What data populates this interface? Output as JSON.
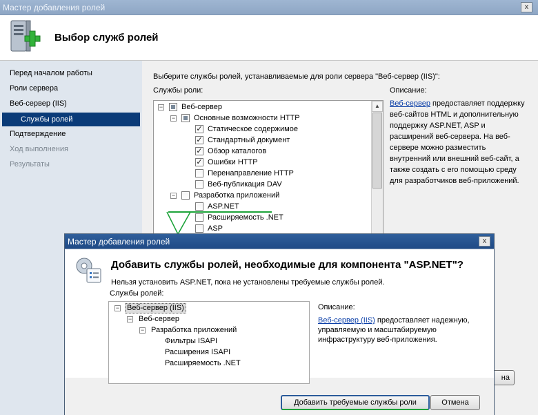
{
  "main_window": {
    "title": "Мастер добавления ролей",
    "close_glyph": "x",
    "header_title": "Выбор служб ролей",
    "nav": [
      {
        "label": "Перед началом работы",
        "state": "normal"
      },
      {
        "label": "Роли сервера",
        "state": "normal"
      },
      {
        "label": "Веб-сервер (IIS)",
        "state": "normal"
      },
      {
        "label": "Службы ролей",
        "state": "active"
      },
      {
        "label": "Подтверждение",
        "state": "normal"
      },
      {
        "label": "Ход выполнения",
        "state": "disabled"
      },
      {
        "label": "Результаты",
        "state": "disabled"
      }
    ],
    "instruction": "Выберите службы ролей, устанавливаемые для роли сервера \"Веб-сервер (IIS)\":",
    "services_label": "Службы роли:",
    "description_label": "Описание:",
    "tree": [
      {
        "label": "Веб-сервер",
        "level": 0,
        "checkbox": "partial",
        "expander": "−"
      },
      {
        "label": "Основные возможности HTTP",
        "level": 1,
        "checkbox": "partial",
        "expander": "−"
      },
      {
        "label": "Статическое содержимое",
        "level": 2,
        "checkbox": "checked"
      },
      {
        "label": "Стандартный документ",
        "level": 2,
        "checkbox": "checked"
      },
      {
        "label": "Обзор каталогов",
        "level": 2,
        "checkbox": "checked"
      },
      {
        "label": "Ошибки HTTP",
        "level": 2,
        "checkbox": "checked"
      },
      {
        "label": "Перенаправление HTTP",
        "level": 2,
        "checkbox": "unchecked"
      },
      {
        "label": "Веб-публикация DAV",
        "level": 2,
        "checkbox": "unchecked"
      },
      {
        "label": "Разработка приложений",
        "level": 1,
        "checkbox": "unchecked",
        "expander": "−"
      },
      {
        "label": "ASP.NET",
        "level": 2,
        "checkbox": "unchecked"
      },
      {
        "label": "Расширяемость .NET",
        "level": 2,
        "checkbox": "unchecked"
      },
      {
        "label": "ASP",
        "level": 2,
        "checkbox": "unchecked"
      }
    ],
    "description": {
      "link": "Веб-сервер",
      "text": " предоставляет поддержку веб-сайтов HTML и дополнительную поддержку ASP.NET, ASP и расширений веб-сервера. На веб-сервере можно разместить внутренний или внешний веб-сайт, а также создать с его помощью среду для разработчиков веб-приложений."
    },
    "partial_button_text": "на"
  },
  "dialog": {
    "title": "Мастер добавления ролей",
    "close_glyph": "x",
    "heading": "Добавить службы ролей, необходимые для компонента \"ASP.NET\"?",
    "subtitle": "Нельзя установить ASP.NET, пока не установлены требуемые службы ролей.",
    "services_label": "Службы ролей:",
    "description_label": "Описание:",
    "tree": [
      {
        "label": "Веб-сервер (IIS)",
        "level": 0,
        "expander": "−",
        "selected": true
      },
      {
        "label": "Веб-сервер",
        "level": 1,
        "expander": "−"
      },
      {
        "label": "Разработка приложений",
        "level": 2,
        "expander": "−"
      },
      {
        "label": "Фильтры ISAPI",
        "level": 3
      },
      {
        "label": "Расширения ISAPI",
        "level": 3
      },
      {
        "label": "Расширяемость .NET",
        "level": 3
      }
    ],
    "description": {
      "link": "Веб-сервер (IIS)",
      "text": " предоставляет надежную, управляемую и масштабируемую инфраструктуру веб-приложения."
    },
    "add_button": "Добавить требуемые службы роли",
    "cancel_button": "Отмена"
  },
  "colors": {
    "accent_nav": "#0a3b78",
    "link": "#0b3fa8",
    "annotation_green": "#1da33a"
  }
}
